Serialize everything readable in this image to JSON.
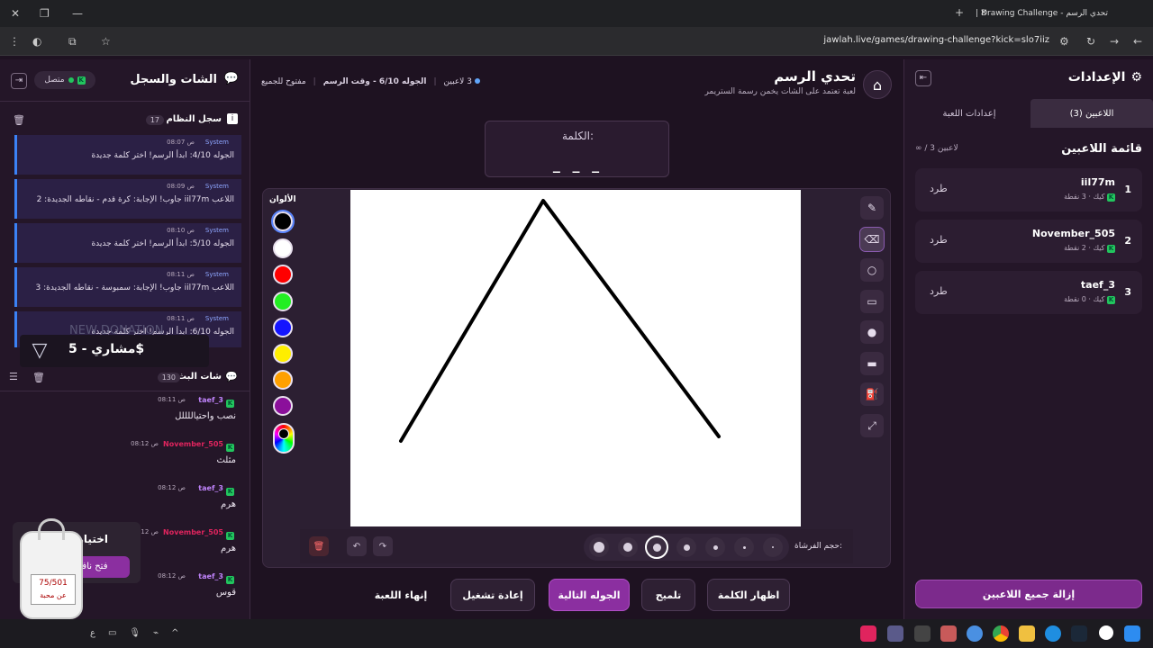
{
  "browser": {
    "tab_title": "تحدي الرسم - Drawing Challenge |",
    "url": "jawlah.live/games/drawing-challenge?kick=slo7iiz"
  },
  "settings": {
    "title": "الإعدادات",
    "tabs": [
      {
        "label": "اللاعبين (3)"
      },
      {
        "label": "إعدادات اللعبة"
      }
    ],
    "players_title": "قائمة اللاعبين",
    "players_count": "∞ / 3 لاعبين",
    "players": [
      {
        "rank": "1",
        "name": "iil77m",
        "points": "3 نقطة",
        "platform": "كيك",
        "kick": "طرد"
      },
      {
        "rank": "2",
        "name": "November_505",
        "points": "2 نقطة",
        "platform": "كيك",
        "kick": "طرد"
      },
      {
        "rank": "3",
        "name": "taef_3",
        "points": "0 نقطة",
        "platform": "كيك",
        "kick": "طرد"
      }
    ],
    "remove_all": "إزالة جميع اللاعبين"
  },
  "header": {
    "title": "تحدي الرسم",
    "subtitle": "لعبة تعتمد على الشات يخمن رسمة الستريمر",
    "players": "3 لاعبين",
    "round": "الجوله 6/10 - وقت الرسم",
    "open": "مفتوح للجميع"
  },
  "word": {
    "label": "الكلمة:",
    "value": "_ _ _"
  },
  "canvas": {
    "colors_label": "الألوان",
    "colors": [
      "#000000",
      "#ffffff",
      "#ff0000",
      "#22ee22",
      "#1414ff",
      "#ffee00",
      "#ffa000",
      "#8b0f9b"
    ],
    "brush_label": "حجم الفرشاة:",
    "stroke_color": "#000000"
  },
  "actions": {
    "end": "إنهاء اللعبة",
    "restart": "إعادة تشغيل",
    "next": "الجوله التالية",
    "hint": "تلميح",
    "show_word": "اظهار الكلمة"
  },
  "chat": {
    "title": "الشات والسجل",
    "online": "متصل",
    "system_title": "سجل النظام",
    "system_count": "17",
    "system_messages": [
      {
        "sender": "System",
        "time": "08:07 ص",
        "text": "الجوله 4/10: ابدأ الرسم! اختر كلمة جديدة"
      },
      {
        "sender": "System",
        "time": "08:09 ص",
        "text": "اللاعب iil77m جاوب! الإجابة: كرة قدم - نقاطه الجديدة: 2"
      },
      {
        "sender": "System",
        "time": "08:10 ص",
        "text": "الجوله 5/10: ابدأ الرسم! اختر كلمة جديدة"
      },
      {
        "sender": "System",
        "time": "08:11 ص",
        "text": "اللاعب iil77m جاوب! الإجابة: سمبوسة - نقاطه الجديدة: 3"
      },
      {
        "sender": "System",
        "time": "08:11 ص",
        "text": "الجوله 6/10: ابدأ الرسم! اختر كلمة جديدة"
      }
    ],
    "stream_title": "شات البث",
    "stream_count": "130",
    "messages": [
      {
        "user": "taef_3",
        "time": "08:11 ص",
        "text": "نصب واحتياللللل",
        "color": "#c084fc"
      },
      {
        "user": "November_505",
        "time": "08:12 ص",
        "text": "مثلث",
        "color": "#e0245e"
      },
      {
        "user": "taef_3",
        "time": "08:12 ص",
        "text": "هرم",
        "color": "#c084fc"
      },
      {
        "user": "November_505",
        "time": "08:12 ص",
        "text": "هرم",
        "color": "#e0245e"
      },
      {
        "user": "taef_3",
        "time": "08:12 ص",
        "text": "قوس",
        "color": "#c084fc"
      }
    ]
  },
  "donation": {
    "ghost": "NEW DONATION",
    "text": "مشاري - 5$"
  },
  "overlay": {
    "title": "اختيار",
    "button": "فتح نافـ",
    "bag_top": "75/501",
    "bag_bottom": "عن محبة"
  }
}
